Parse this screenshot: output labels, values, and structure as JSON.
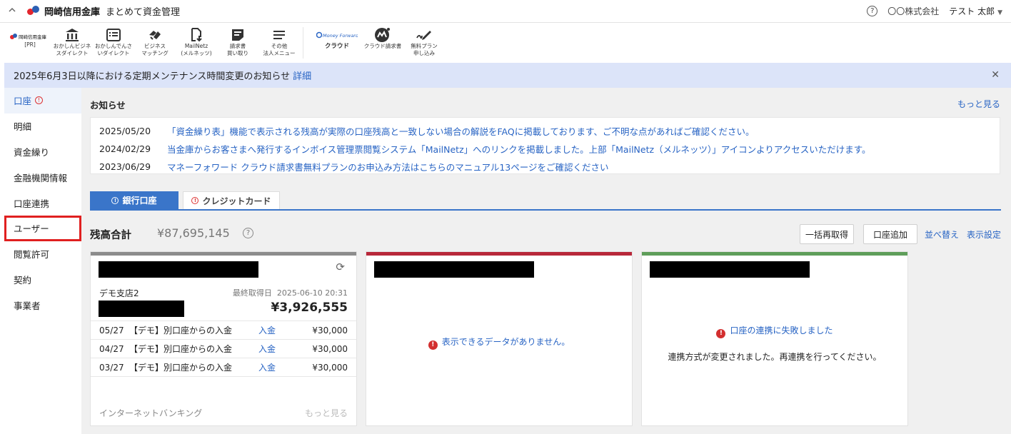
{
  "header": {
    "logo_text": "岡崎信用金庫",
    "app_title": "まとめて資金管理",
    "company": "〇〇株式会社",
    "username": "テスト 太郎"
  },
  "toolbar": {
    "first": {
      "brand": "岡崎信用金庫",
      "label": "[PR]"
    },
    "items": [
      {
        "icon": "bank-icon",
        "label": "おかしんビジネ\nスダイレクト"
      },
      {
        "icon": "list-icon",
        "label": "おかしんでんさ\nいダイレクト"
      },
      {
        "icon": "handshake-icon",
        "label": "ビジネス\nマッチング"
      },
      {
        "icon": "document-download-icon",
        "label": "MailNetz\n(メルネッツ)"
      },
      {
        "icon": "invoice-icon",
        "label": "請求書\n買い取り"
      },
      {
        "icon": "menu-icon",
        "label": "その他\n法人メニュー"
      }
    ],
    "mf": {
      "brand": "Money Forward",
      "label": "クラウド"
    },
    "mf_items": [
      {
        "icon": "mf-invoice-icon",
        "label": "クラウド請求書"
      },
      {
        "icon": "pen-icon",
        "label": "無料プラン\n申し込み"
      }
    ]
  },
  "banner": {
    "text": "2025年6月3日以降における定期メンテナンス時間変更のお知らせ",
    "link": "詳細"
  },
  "sidebar": {
    "items": [
      {
        "label": "口座"
      },
      {
        "label": "明細"
      },
      {
        "label": "資金繰り"
      },
      {
        "label": "金融機関情報"
      },
      {
        "label": "口座連携"
      },
      {
        "label": "ユーザー"
      },
      {
        "label": "閲覧許可"
      },
      {
        "label": "契約"
      },
      {
        "label": "事業者"
      }
    ]
  },
  "notices": {
    "title": "お知らせ",
    "more": "もっと見る",
    "items": [
      {
        "date": "2025/05/20",
        "text": "「資金繰り表」機能で表示される残高が実際の口座残高と一致しない場合の解説をFAQに掲載しております、ご不明な点があればご確認ください。"
      },
      {
        "date": "2024/02/29",
        "text": "当金庫からお客さまへ発行するインボイス管理票閲覧システム「MailNetz」へのリンクを掲載しました。上部「MailNetz（メルネッツ）」アイコンよりアクセスいただけます。"
      },
      {
        "date": "2023/06/29",
        "text": "マネーフォワード クラウド請求書無料プランのお申込み方法はこちらのマニュアル13ページをご確認ください"
      }
    ]
  },
  "tabs": [
    {
      "label": "銀行口座"
    },
    {
      "label": "クレジットカード"
    }
  ],
  "balance": {
    "label": "残高合計",
    "value": "¥87,695,145",
    "buttons": {
      "refetch": "一括再取得",
      "add": "口座追加",
      "sort": "並べ替え",
      "display": "表示設定"
    }
  },
  "cards": {
    "first": {
      "bar_color": "#8c8c8c",
      "branch": "デモ支店2",
      "fetched_label": "最終取得日",
      "fetched_at": "2025-06-10 20:31",
      "amount": "¥3,926,555",
      "transactions": [
        {
          "date": "05/27",
          "desc": "【デモ】別口座からの入金",
          "type": "入金",
          "amount": "¥30,000"
        },
        {
          "date": "04/27",
          "desc": "【デモ】別口座からの入金",
          "type": "入金",
          "amount": "¥30,000"
        },
        {
          "date": "03/27",
          "desc": "【デモ】別口座からの入金",
          "type": "入金",
          "amount": "¥30,000"
        }
      ],
      "footer_left": "インターネットバンキング",
      "footer_right": "もっと見る"
    },
    "second": {
      "bar_color": "#b8283a",
      "message": "表示できるデータがありません。"
    },
    "third": {
      "bar_color": "#5f9e5a",
      "message": "口座の連携に失敗しました",
      "sub_message": "連携方式が変更されました。再連携を行ってください。"
    }
  },
  "colors": {
    "accent": "#2864c4",
    "tab_active": "#3a75c9",
    "banner_bg": "#dce4f9",
    "error": "#d32f2f",
    "highlight": "#e02020"
  }
}
